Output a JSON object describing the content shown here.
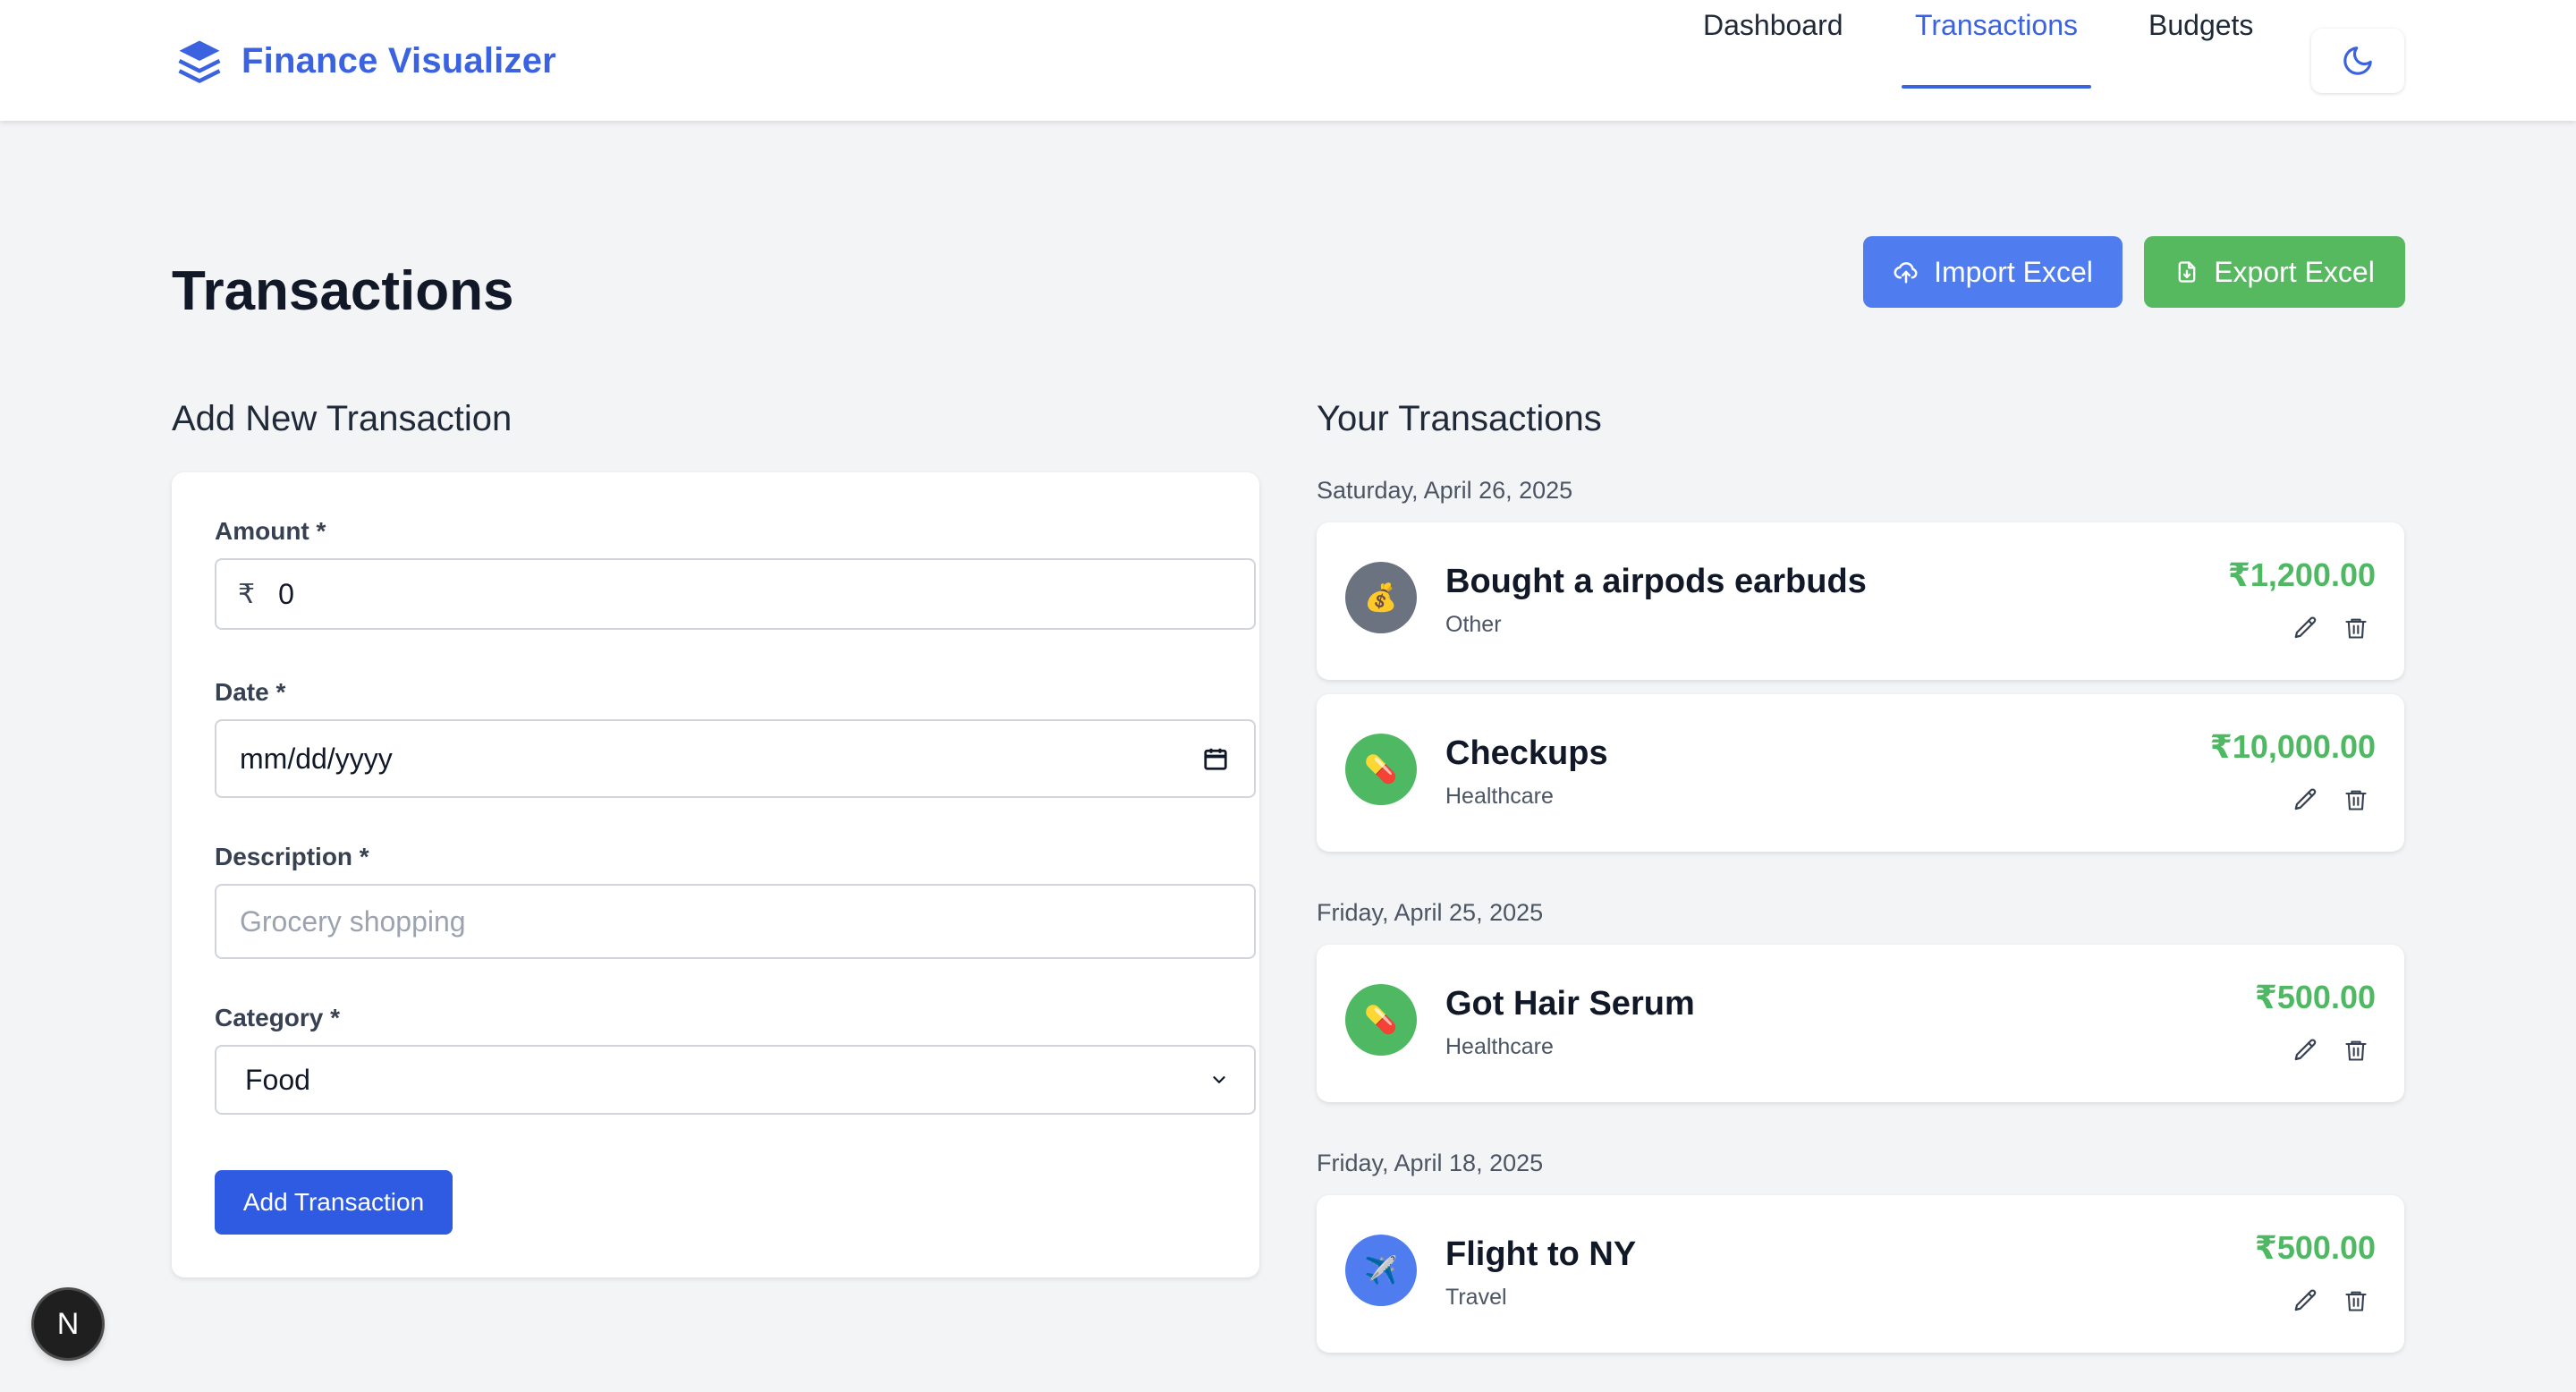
{
  "app": {
    "brand": "Finance Visualizer",
    "accent_color": "#3b63e0"
  },
  "nav": {
    "items": [
      {
        "label": "Dashboard",
        "active": false
      },
      {
        "label": "Transactions",
        "active": true
      },
      {
        "label": "Budgets",
        "active": false
      }
    ],
    "theme_toggle_icon": "moon-icon"
  },
  "page": {
    "title": "Transactions",
    "import_label": "Import Excel",
    "export_label": "Export Excel"
  },
  "form": {
    "heading": "Add New Transaction",
    "amount": {
      "label": "Amount *",
      "prefix": "₹",
      "value": "0"
    },
    "date": {
      "label": "Date *",
      "value": "mm/dd/yyyy"
    },
    "description": {
      "label": "Description *",
      "placeholder": "Grocery shopping"
    },
    "category": {
      "label": "Category *",
      "selected": "Food"
    },
    "submit_label": "Add Transaction"
  },
  "list": {
    "heading": "Your Transactions",
    "groups": [
      {
        "date": "Saturday, April 26, 2025",
        "items": [
          {
            "title": "Bought a airpods earbuds",
            "category": "Other",
            "amount": "₹1,200.00",
            "emoji": "💰",
            "color": "#6b7280"
          },
          {
            "title": "Checkups",
            "category": "Healthcare",
            "amount": "₹10,000.00",
            "emoji": "💊",
            "color": "#4fb862"
          }
        ]
      },
      {
        "date": "Friday, April 25, 2025",
        "items": [
          {
            "title": "Got Hair Serum",
            "category": "Healthcare",
            "amount": "₹500.00",
            "emoji": "💊",
            "color": "#4fb862"
          }
        ]
      },
      {
        "date": "Friday, April 18, 2025",
        "items": [
          {
            "title": "Flight to NY",
            "category": "Travel",
            "amount": "₹500.00",
            "emoji": "✈️",
            "color": "#4f7df0"
          }
        ]
      }
    ]
  },
  "floating_badge": {
    "label": "N"
  }
}
